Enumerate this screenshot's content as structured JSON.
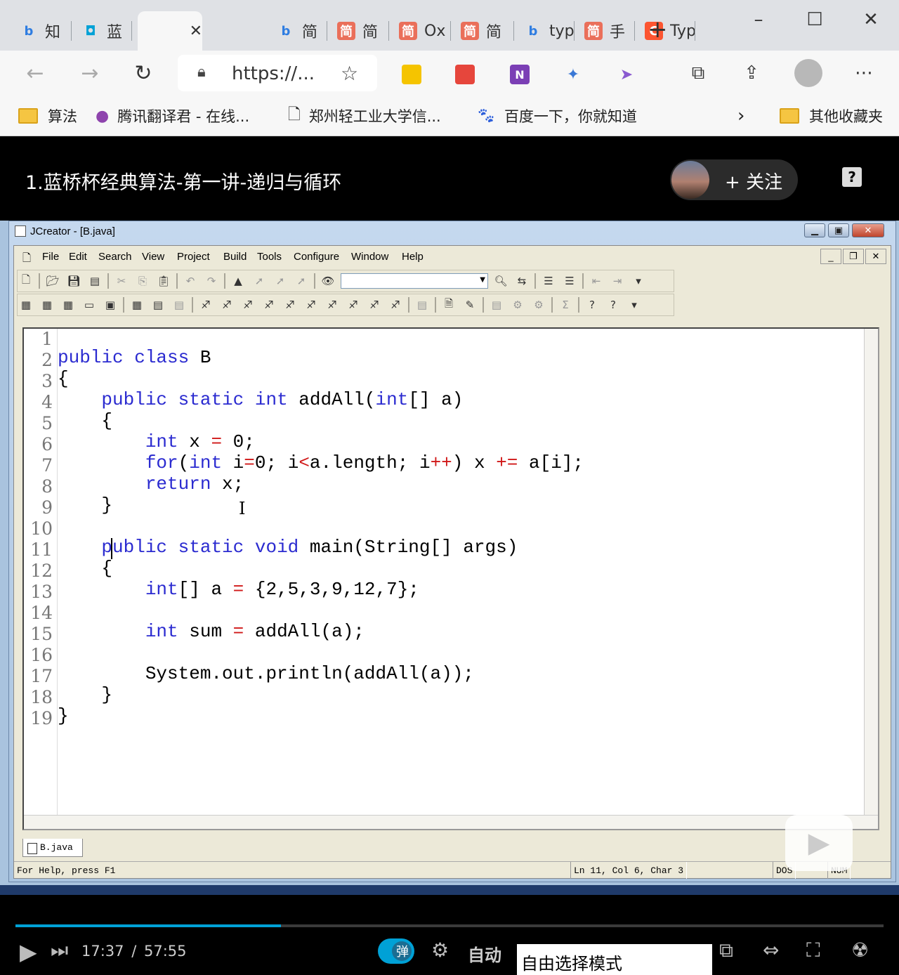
{
  "browser": {
    "tabs": [
      {
        "label": "知",
        "icon": "bing-icon",
        "color": "#2f7de1"
      },
      {
        "label": "蓝",
        "icon": "bilibili-icon",
        "color": "#00a1d6"
      },
      {
        "label": "【",
        "icon": "page-icon",
        "color": "#333333",
        "active": true
      },
      {
        "label": "简",
        "icon": "bing-icon",
        "color": "#2f7de1"
      },
      {
        "label": "简",
        "icon": "jianshu-icon",
        "color": "#ea6f5a"
      },
      {
        "label": "Ox",
        "icon": "jianshu-icon",
        "color": "#ea6f5a"
      },
      {
        "label": "简",
        "icon": "jianshu-icon",
        "color": "#ea6f5a"
      },
      {
        "label": "typ",
        "icon": "bing-icon",
        "color": "#2f7de1"
      },
      {
        "label": "手",
        "icon": "jianshu-icon",
        "color": "#ea6f5a"
      },
      {
        "label": "Typ",
        "icon": "csdn-icon",
        "color": "#fc5531"
      }
    ],
    "url": "https://...",
    "bookmarks": [
      "算法",
      "腾讯翻译君 - 在线...",
      "郑州轻工业大学信...",
      "百度一下，你就知道"
    ],
    "other_bookmarks": "其他收藏夹"
  },
  "video": {
    "title": "1.蓝桥杯经典算法-第一讲-递归与循环",
    "follow_label": "关注",
    "current_time": "17:37",
    "separator": "/",
    "total_time": "57:55",
    "progress_fraction": 0.306,
    "danmu_label": "弹",
    "quality_label": "自动",
    "tooltip": "自由选择模式",
    "accent_color": "#00a1d6"
  },
  "jcreator": {
    "title": "JCreator - [B.java]",
    "menu": [
      "File",
      "Edit",
      "Search",
      "View",
      "Project",
      "Build",
      "Tools",
      "Configure",
      "Window",
      "Help"
    ],
    "line_numbers": [
      "1",
      "2",
      "3",
      "4",
      "5",
      "6",
      "7",
      "8",
      "9",
      "10",
      "11",
      "12",
      "13",
      "14",
      "15",
      "16",
      "17",
      "18",
      "19"
    ],
    "file_tab": "B.java",
    "status_help": "For Help, press F1",
    "status_pos": "Ln 11, Col 6, Char 3",
    "status_dos": "DOS",
    "status_num": "NUM"
  }
}
